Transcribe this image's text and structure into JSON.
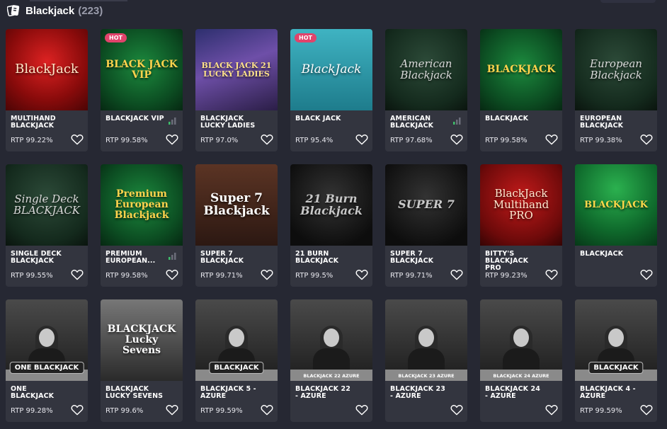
{
  "header": {
    "title": "Blackjack",
    "count": "(223)"
  },
  "games": [
    {
      "name": "MULTIHAND BLACKJACK",
      "rtp": "RTP 99.22%",
      "hot": false,
      "signal": false,
      "art": "BlackJack",
      "theme": "red"
    },
    {
      "name": "BLACKJACK VIP",
      "rtp": "RTP 99.58%",
      "hot": true,
      "signal": true,
      "art": "BLACK JACK VIP",
      "theme": "green"
    },
    {
      "name": "BLACKJACK LUCKY LADIES",
      "rtp": "RTP 97.0%",
      "hot": false,
      "signal": false,
      "art": "BLACK JACK 21 LUCKY LADIES",
      "theme": "purple"
    },
    {
      "name": "BLACK JACK",
      "rtp": "RTP 95.4%",
      "hot": true,
      "signal": false,
      "art": "BlackJack",
      "theme": "teal"
    },
    {
      "name": "AMERICAN BLACKJACK",
      "rtp": "RTP 97.68%",
      "hot": false,
      "signal": true,
      "art": "American Blackjack",
      "theme": "darkgreen"
    },
    {
      "name": "BLACKJACK",
      "rtp": "RTP 99.58%",
      "hot": false,
      "signal": false,
      "art": "BLACKJACK",
      "theme": "green"
    },
    {
      "name": "EUROPEAN BLACKJACK",
      "rtp": "RTP 99.38%",
      "hot": false,
      "signal": false,
      "art": "European Blackjack",
      "theme": "darkgreen"
    },
    {
      "name": "SINGLE DECK BLACKJACK",
      "rtp": "RTP 99.55%",
      "hot": false,
      "signal": false,
      "art": "Single Deck BLACKJACK",
      "theme": "darkgreen"
    },
    {
      "name": "PREMIUM EUROPEAN...",
      "rtp": "RTP 99.58%",
      "hot": false,
      "signal": true,
      "art": "Premium European Blackjack",
      "theme": "green"
    },
    {
      "name": "SUPER 7 BLACKJACK",
      "rtp": "RTP 99.71%",
      "hot": false,
      "signal": false,
      "art": "Super 7 Blackjack",
      "theme": "brown"
    },
    {
      "name": "21 BURN BLACKJACK",
      "rtp": "RTP 99.5%",
      "hot": false,
      "signal": false,
      "art": "21 Burn Blackjack",
      "theme": "black"
    },
    {
      "name": "SUPER 7 BLACKJACK",
      "rtp": "RTP 99.71%",
      "hot": false,
      "signal": false,
      "art": "SUPER 7",
      "theme": "black"
    },
    {
      "name": "BITTY'S BLACKJACK PRO",
      "rtp": "RTP 99.23%",
      "hot": false,
      "signal": false,
      "art": "BlackJack Multihand PRO",
      "theme": "red2"
    },
    {
      "name": "BLACKJACK",
      "rtp": "",
      "hot": false,
      "signal": false,
      "art": "BLACKJACK",
      "theme": "lightgreen"
    },
    {
      "name": "ONE BLACKJACK",
      "rtp": "RTP 99.28%",
      "hot": false,
      "signal": false,
      "art": "ONE BLACKJACK",
      "theme": "live"
    },
    {
      "name": "BLACKJACK LUCKY SEVENS",
      "rtp": "RTP 99.6%",
      "hot": false,
      "signal": false,
      "art": "BLACKJACK Lucky Sevens",
      "theme": "gray2"
    },
    {
      "name": "BLACKJACK 5 - AZURE",
      "rtp": "RTP 99.59%",
      "hot": false,
      "signal": false,
      "art": "BLACKJACK",
      "theme": "live"
    },
    {
      "name": "BLACKJACK 22 - AZURE",
      "rtp": "",
      "hot": false,
      "signal": false,
      "art": "BLACKJACK 22 AZURE",
      "theme": "live"
    },
    {
      "name": "BLACKJACK 23 - AZURE",
      "rtp": "",
      "hot": false,
      "signal": false,
      "art": "BLACKJACK 23 AZURE",
      "theme": "live"
    },
    {
      "name": "BLACKJACK 24 - AZURE",
      "rtp": "",
      "hot": false,
      "signal": false,
      "art": "BLACKJACK 24 AZURE",
      "theme": "live"
    },
    {
      "name": "BLACKJACK 4 - AZURE",
      "rtp": "RTP 99.59%",
      "hot": false,
      "signal": false,
      "art": "BLACKJACK",
      "theme": "live"
    }
  ],
  "labels": {
    "hot": "HOT"
  },
  "icons": {
    "category": "cards-icon",
    "favorite": "heart-icon",
    "signal": "signal-bars-icon"
  },
  "colors": {
    "background": "#262833",
    "card": "#33353f",
    "hot": "#e0436b",
    "signal_active": "#3fbf6b",
    "signal_inactive": "#6b6d7a"
  }
}
